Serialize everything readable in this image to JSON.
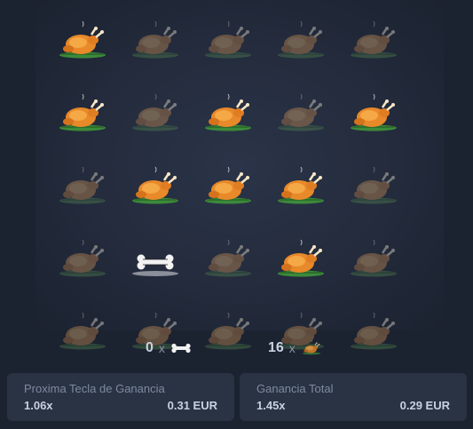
{
  "board": {
    "tiles": [
      "chicken",
      "chicken-dim",
      "chicken-dim",
      "chicken-dim",
      "chicken-dim",
      "chicken",
      "chicken-dim",
      "chicken",
      "chicken-dim",
      "chicken",
      "chicken-dim",
      "chicken",
      "chicken",
      "chicken",
      "chicken-dim",
      "chicken-dim",
      "bone",
      "chicken-dim",
      "chicken",
      "chicken-dim",
      "chicken-dim",
      "chicken-dim",
      "chicken-dim",
      "chicken-dim",
      "chicken-dim"
    ]
  },
  "counters": {
    "bones": {
      "count": "0",
      "sep": "x",
      "icon": "bone-icon"
    },
    "chickens": {
      "count": "16",
      "sep": "x",
      "icon": "chicken-icon"
    }
  },
  "panels": {
    "next": {
      "title": "Proxima Tecla de Ganancia",
      "multiplier": "1.06x",
      "amount": "0.31 EUR"
    },
    "total": {
      "title": "Ganancia Total",
      "multiplier": "1.45x",
      "amount": "0.29 EUR"
    }
  },
  "colors": {
    "background": "#1b2230",
    "panel": "#2a3344",
    "chicken_skin": "#e8892a",
    "plate": "#3c8a3a"
  }
}
